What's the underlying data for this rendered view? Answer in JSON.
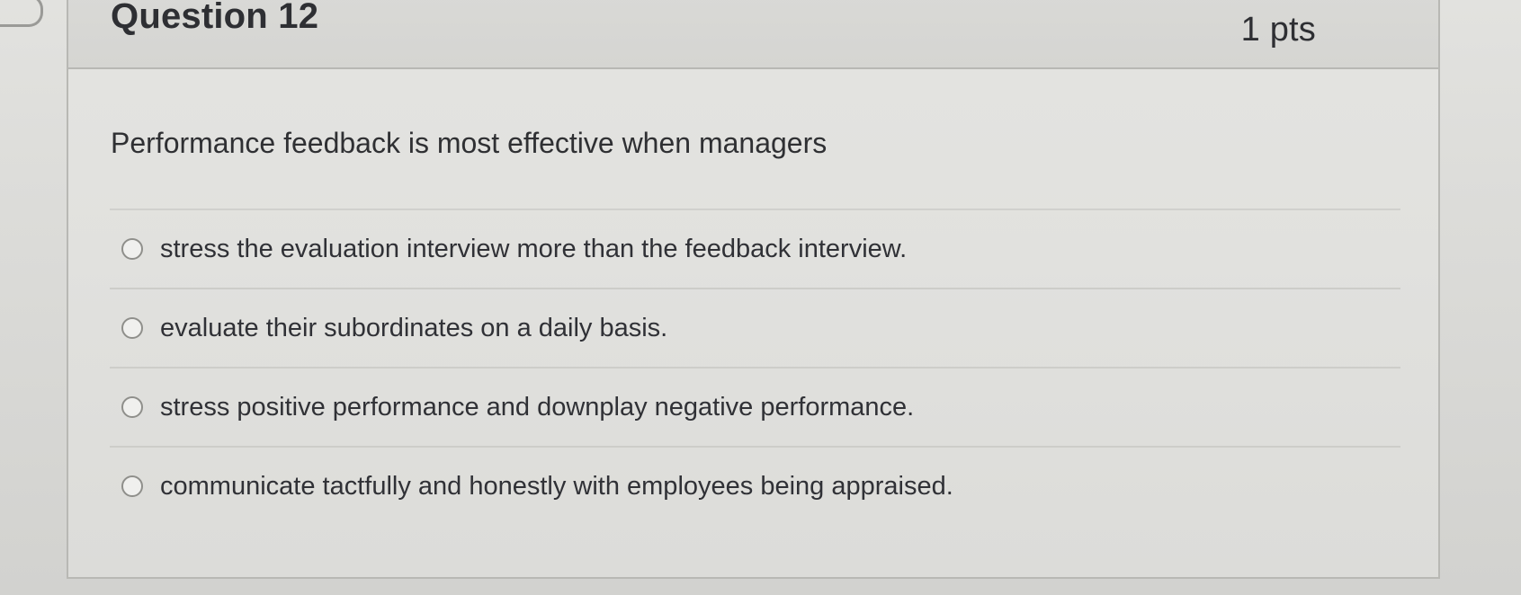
{
  "question": {
    "title": "Question 12",
    "points": "1 pts",
    "text": "Performance feedback is most effective when managers"
  },
  "answers": [
    {
      "label": "stress the evaluation interview more than the feedback interview."
    },
    {
      "label": "evaluate their subordinates on a daily basis."
    },
    {
      "label": "stress positive performance and downplay negative performance."
    },
    {
      "label": "communicate tactfully and honestly with employees being appraised."
    }
  ]
}
